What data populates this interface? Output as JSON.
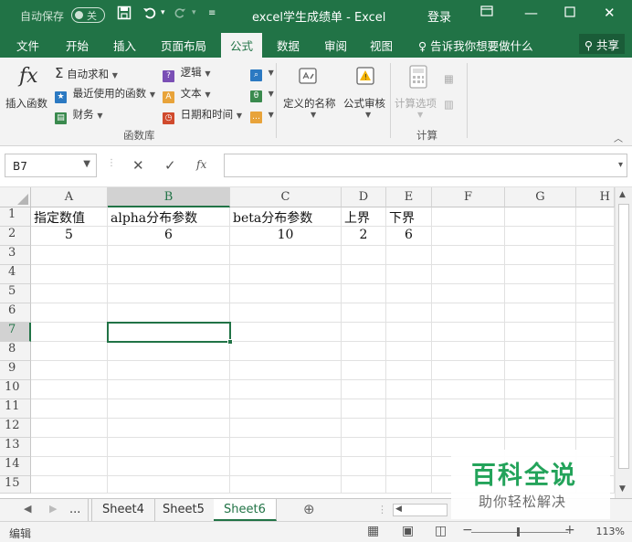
{
  "titlebar": {
    "autosave_label": "自动保存",
    "autosave_state": "关",
    "document_title": "excel学生成绩单  -  Excel",
    "login_label": "登录"
  },
  "tabs": [
    "文件",
    "开始",
    "插入",
    "页面布局",
    "公式",
    "数据",
    "审阅",
    "视图"
  ],
  "active_tab": "公式",
  "tell_me": "告诉我你想要做什么",
  "share_label": "共享",
  "ribbon": {
    "insert_function": "插入函数",
    "autosum": "自动求和",
    "recent": "最近使用的函数",
    "financial": "财务",
    "logical": "逻辑",
    "text": "文本",
    "datetime": "日期和时间",
    "group_library": "函数库",
    "defined_names": "定义的名称",
    "formula_audit": "公式审核",
    "calc_options": "计算选项",
    "group_calc": "计算"
  },
  "formula_bar": {
    "name_box": "B7",
    "fx": "fx",
    "formula": ""
  },
  "columns": [
    "A",
    "B",
    "C",
    "D",
    "E",
    "F",
    "G",
    "H"
  ],
  "rows": [
    "1",
    "2",
    "3",
    "4",
    "5",
    "6",
    "7",
    "8",
    "9",
    "10",
    "11",
    "12",
    "13",
    "14",
    "15"
  ],
  "cells": {
    "headers": [
      "指定数值",
      "alpha分布参数",
      "beta分布参数",
      "上界",
      "下界"
    ],
    "values": [
      "5",
      "6",
      "10",
      "2",
      "6"
    ]
  },
  "sheets": {
    "ellipsis": "...",
    "tabs": [
      "Sheet4",
      "Sheet5",
      "Sheet6"
    ],
    "active": "Sheet6"
  },
  "status": {
    "mode": "编辑",
    "zoom": "113%"
  },
  "watermark": {
    "title": "百科全说",
    "subtitle": "助你轻松解决"
  },
  "colors": {
    "accent": "#217346",
    "watermark_green": "#23a35a"
  }
}
